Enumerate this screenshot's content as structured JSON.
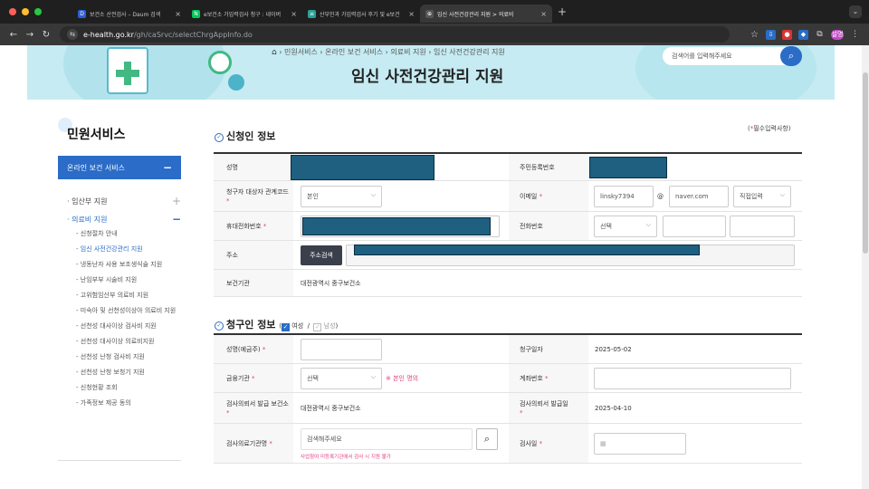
{
  "browser": {
    "tabs": [
      {
        "label": "보건소 산전검사 – Daum 검색",
        "fav": "D",
        "color": "#2c5ed6",
        "active": false
      },
      {
        "label": "e보건소 가임력검사 청구 : 네이버",
        "fav": "N",
        "color": "#03c75a",
        "active": false
      },
      {
        "label": "산부인과 가임력검사 후기 및 e보건",
        "fav": "≡",
        "color": "#2aa198",
        "active": false
      },
      {
        "label": "임신 사전건강관리 지원 > 의료비",
        "fav": "⊕",
        "color": "#555555",
        "active": true
      }
    ],
    "url_host": "e-health.go.kr",
    "url_path": "/gh/caSrvc/selectChrgAppInfo.do",
    "profile_label": "설명"
  },
  "header": {
    "breadcrumb": [
      "민원서비스",
      "온라인 보건 서비스",
      "의료비 지원",
      "임신 사전건강관리 지원"
    ],
    "title": "임신 사전건강관리 지원",
    "search_placeholder": "검색어를 입력해주세요"
  },
  "sidebar": {
    "title": "민원서비스",
    "menu_head": "온라인 보건 서비스",
    "items": [
      {
        "label": "· 임산부 지원",
        "pm": "+"
      },
      {
        "label": "· 의료비 지원",
        "pm": "−"
      }
    ],
    "subitems": [
      "- 신청절차 안내",
      "- 임신 사전건강관리 지원",
      "- 냉동난자 사용 보조생식술 지원",
      "- 난임부부 시술비 지원",
      "- 고위험임산부 의료비 지원",
      "- 미숙아 및 선천성이상아 의료비 지원",
      "- 선천성 대사이상 검사비 지원",
      "- 선천성 대사이상 의료비지원",
      "- 선천성 난청 검사비 지원",
      "- 선천성 난청 보청기 지원",
      "- 신청현황 조회",
      "- 가족정보 제공 동의"
    ]
  },
  "applicant": {
    "section_title": "신청인 정보",
    "required_note": "필수입력사항",
    "name_label": "성명",
    "rrn_label": "주민등록번호",
    "relation_label": "청구자 대상자 관계코드",
    "relation_value": "본인",
    "email_label": "이메일",
    "email_id": "linsky7394",
    "email_at": "@",
    "email_domain": "naver.com",
    "email_select": "직접입력",
    "mobile_label": "휴대전화번호",
    "phone_label": "전화번호",
    "phone_select": "선택",
    "address_label": "주소",
    "address_button": "주소검색",
    "health_center_label": "보건기관",
    "health_center_value": "대전광역시 중구보건소"
  },
  "claimant": {
    "section_title": "청구인 정보",
    "female_label": "여성",
    "male_label": "남성",
    "slash": "/",
    "depositor_label": "성명(예금주)",
    "claim_date_label": "청구일자",
    "claim_date_value": "2025-05-02",
    "bank_label": "금융기관",
    "bank_select": "선택",
    "bank_note": "※ 본인 명의",
    "account_label": "계좌번호",
    "issuer_label": "검사의뢰서 발급 보건소",
    "issuer_value": "대전광역시 중구보건소",
    "issue_date_label": "검사의뢰서 발급일",
    "issue_date_value": "2025-04-10",
    "facility_label": "검사의료기관명",
    "facility_placeholder": "검색해주세요",
    "facility_hint": "사업참여 미등록기관에서 검사 시 지원 불가",
    "exam_date_label": "검사일"
  }
}
